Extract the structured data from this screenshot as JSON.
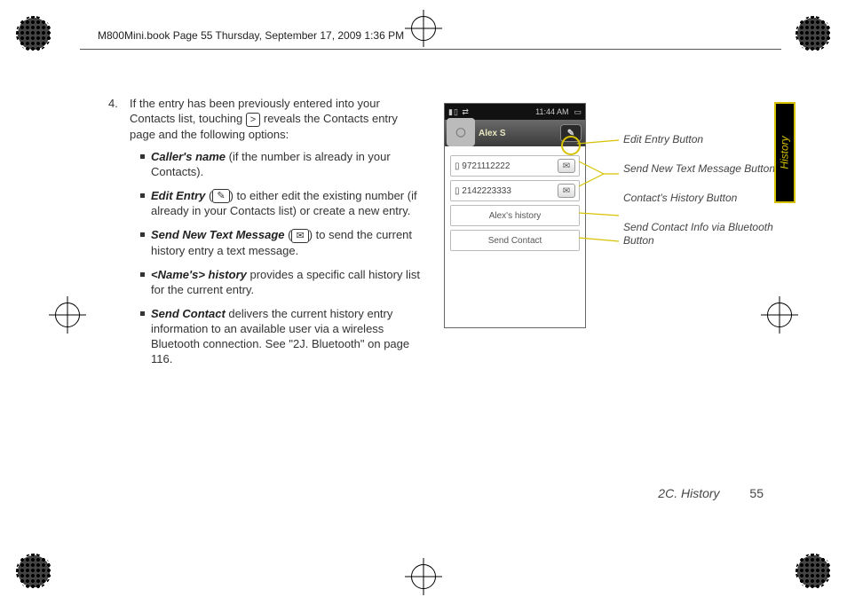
{
  "header": "M800Mini.book  Page 55  Thursday, September 17, 2009  1:36 PM",
  "step": {
    "number": "4.",
    "intro_a": "If the entry has been previously entered into your Contacts list, touching ",
    "chip1": ">",
    "intro_b": " reveals the Contacts entry page and the following options:"
  },
  "bullets": [
    {
      "term": "Caller's name",
      "rest": " (if the number is already in your Contacts)."
    },
    {
      "term": "Edit Entry",
      "pre": " (",
      "chip": "✎",
      "post": ") to either edit the existing number (if already in your Contacts list) or create a new entry."
    },
    {
      "term": "Send New Text Message",
      "pre": " (",
      "chip": "✉",
      "post": ") to send the current history entry a text message."
    },
    {
      "term": "<Name's> history",
      "rest": " provides a specific call history list for the current entry."
    },
    {
      "term": "Send Contact",
      "rest": " delivers the current history entry information to an available user via a wireless Bluetooth connection. See \"2J. Bluetooth\" on page 116."
    }
  ],
  "phone": {
    "status_left": "▮▯  ⇄",
    "time": "11:44 AM",
    "batt": "▭",
    "title": "Alex S",
    "edit_icon": "✎",
    "avatar_icon": "◯",
    "rows": [
      {
        "icon": "▯",
        "text": "9721112222",
        "btn": "✉"
      },
      {
        "icon": "▯",
        "text": "2142223333",
        "btn": "✉"
      },
      {
        "icon": "",
        "text": "Alex's history",
        "center": true
      },
      {
        "icon": "",
        "text": "Send Contact",
        "center": true
      }
    ]
  },
  "callouts": {
    "c1": "Edit Entry Button",
    "c2": "Send New Text Message Buttons",
    "c3": "Contact's History Button",
    "c4": "Send Contact Info via Bluetooth Button"
  },
  "tab": "History",
  "footer": {
    "section": "2C. History",
    "page": "55"
  }
}
